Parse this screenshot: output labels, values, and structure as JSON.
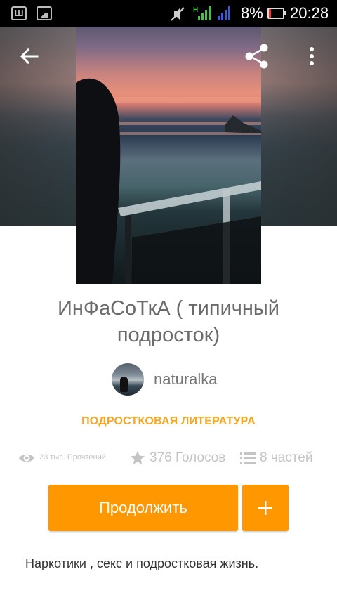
{
  "status_bar": {
    "app_icon_1": "Ш",
    "battery_percent": "8%",
    "time": "20:28",
    "icons": [
      "app-w-icon",
      "image-icon",
      "mute-icon",
      "signal-h-icon",
      "signal-icon",
      "battery-icon"
    ]
  },
  "toolbar": {
    "icons": [
      "back-arrow-icon",
      "share-icon",
      "more-vertical-icon"
    ]
  },
  "story": {
    "title": "ИнФаСоТкА ( типичный подросток)",
    "author": "naturalka",
    "category": "ПОДРОСТКОВАЯ ЛИТЕРАТУРА",
    "reads": "23 тыс. Прочтений",
    "votes": "376 Голосов",
    "parts": "8 частей",
    "description": "Наркотики , секс и подростковая жизнь."
  },
  "actions": {
    "continue_label": "Продолжить",
    "add_icon": "plus-icon"
  },
  "colors": {
    "accent": "#ff9800",
    "category": "#f5a623",
    "stat_gray": "#c4c4c4"
  }
}
